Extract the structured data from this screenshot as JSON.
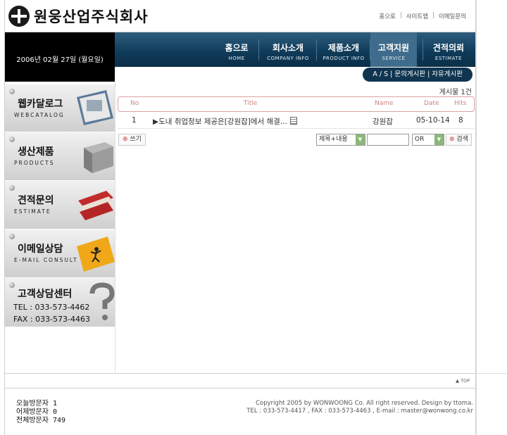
{
  "header": {
    "company_name": "원웅산업주식회사",
    "links": [
      "홈으로",
      "사이트맵",
      "이메일문의"
    ]
  },
  "date_text": "2006년 02월 27일 (월요일)",
  "nav": [
    {
      "ko": "홈으로",
      "en": "HOME"
    },
    {
      "ko": "회사소개",
      "en": "COMPANY INFO"
    },
    {
      "ko": "제품소개",
      "en": "PRODUCT INFO"
    },
    {
      "ko": "고객지원",
      "en": "SERVICE"
    },
    {
      "ko": "견적의뢰",
      "en": "ESTIMATE"
    }
  ],
  "submenu": "A / S  |  문의게시판  |  자유게시판",
  "left_menu": [
    {
      "ko": "웹카달로그",
      "en": "WEBCATALOG"
    },
    {
      "ko": "생산제품",
      "en": "PRODUCTS"
    },
    {
      "ko": "견적문의",
      "en": "ESTIMATE"
    },
    {
      "ko": "이메일상담",
      "en": "E-MAIL CONSULT"
    },
    {
      "ko": "고객상담센터",
      "tel": "TEL : 033-573-4462",
      "fax": "FAX : 033-573-4463"
    }
  ],
  "board": {
    "count_text": "게시물 1건",
    "columns": {
      "no": "No",
      "title": "Title",
      "name": "Name",
      "date": "Date",
      "hits": "Hits"
    },
    "rows": [
      {
        "no": "1",
        "title": "▶도내 취업정보 제공은[강원잡]에서 해결...",
        "name": "강원잡",
        "date": "05-10-14",
        "hits": "8"
      }
    ],
    "write_label": "쓰기",
    "field_select": "제목+내용",
    "op_select": "OR",
    "search_label": "검색"
  },
  "top_label": "▲ TOP",
  "visitors": {
    "today": "오늘방문자 1",
    "yesterday": "어제방문자 0",
    "total": "전체방문자 749"
  },
  "footer": {
    "copyright": "Copyright 2005 by WONWOONG Co. All right reserved. Design by ttoma.",
    "contact": "TEL : 033-573-4417 , FAX : 033-573-4463 , E-mail : master@wonwong.co.kr"
  }
}
